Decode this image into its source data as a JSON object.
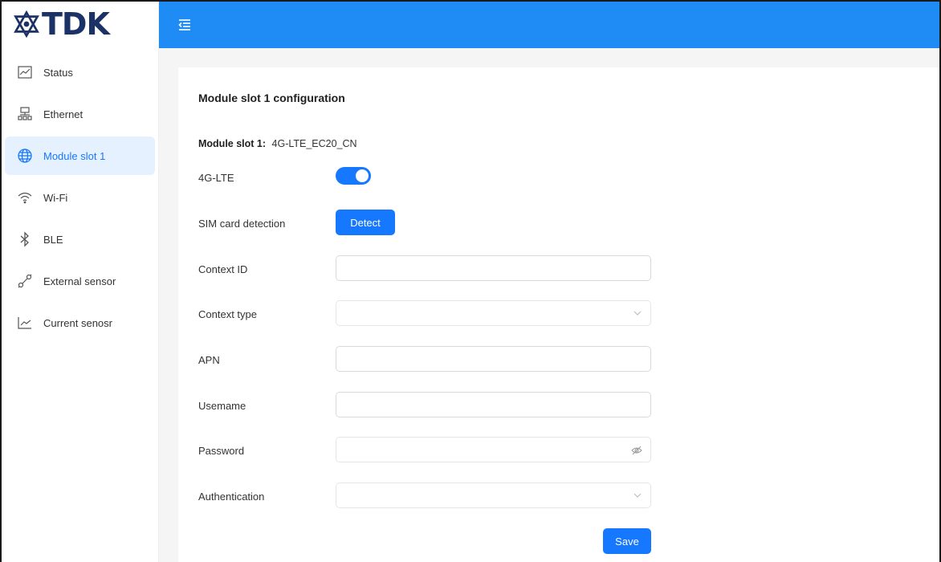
{
  "brand": {
    "logo_text": "TDK"
  },
  "sidebar": {
    "items": [
      {
        "label": "Status",
        "icon": "chart-line-icon"
      },
      {
        "label": "Ethernet",
        "icon": "network-icon"
      },
      {
        "label": "Module slot 1",
        "icon": "globe-icon",
        "active": true
      },
      {
        "label": "Wi-Fi",
        "icon": "wifi-icon"
      },
      {
        "label": "BLE",
        "icon": "bluetooth-icon"
      },
      {
        "label": "External sensor",
        "icon": "api-icon"
      },
      {
        "label": "Current senosr",
        "icon": "chart-line-icon"
      }
    ]
  },
  "header": {
    "collapse_icon": "menu-fold-icon",
    "accent": "#1f8cf5"
  },
  "main": {
    "title": "Module slot 1 configuration",
    "slot_key": "Module slot 1:",
    "slot_value": "4G-LTE_EC20_CN",
    "lte_label": "4G-LTE",
    "lte_enabled": true,
    "sim_label": "SIM card detection",
    "detect_label": "Detect",
    "context_id_label": "Context ID",
    "context_id_value": "",
    "context_type_label": "Context type",
    "context_type_value": "",
    "apn_label": "APN",
    "apn_value": "",
    "username_label": "Usemame",
    "username_value": "",
    "password_label": "Password",
    "password_value": "",
    "auth_label": "Authentication",
    "auth_value": "",
    "save_label": "Save",
    "primary_color": "#1677ff"
  }
}
